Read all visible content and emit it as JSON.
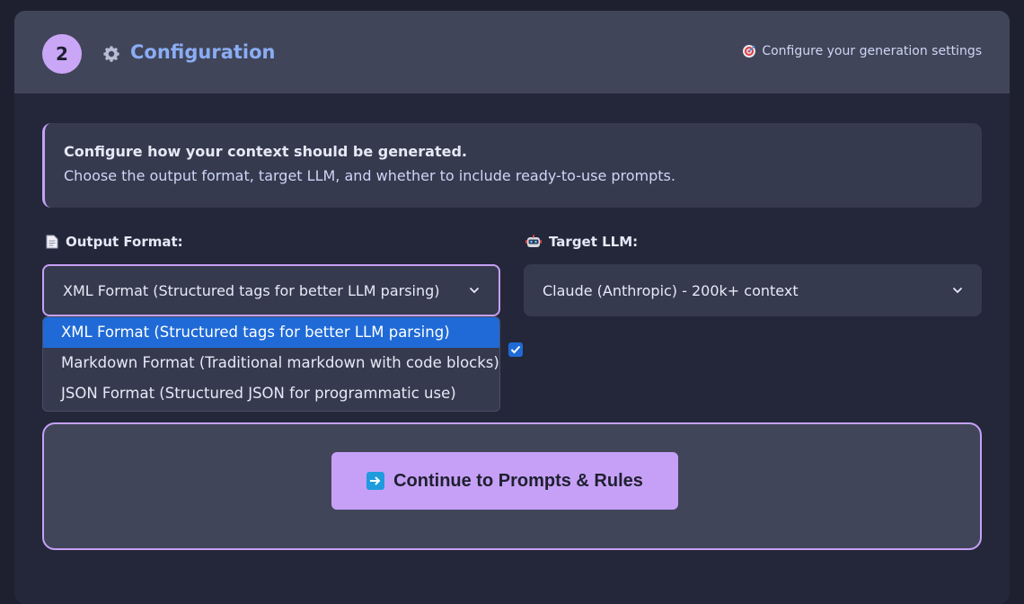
{
  "header": {
    "step_number": "2",
    "title": "Configuration",
    "hint": "Configure your generation settings"
  },
  "info": {
    "strong": "Configure how your context should be generated.",
    "text": "Choose the output format, target LLM, and whether to include ready-to-use prompts."
  },
  "output_format": {
    "label": "Output Format:",
    "selected": "XML Format (Structured tags for better LLM parsing)",
    "options": [
      "XML Format (Structured tags for better LLM parsing)",
      "Markdown Format (Traditional markdown with code blocks)",
      "JSON Format (Structured JSON for programmatic use)"
    ]
  },
  "target_llm": {
    "label": "Target LLM:",
    "selected": "Claude (Anthropic) - 200k+ context"
  },
  "include_prompts": {
    "checked": true
  },
  "continue_button": {
    "label": "Continue to Prompts & Rules"
  },
  "icons": [
    "gear-icon",
    "target-icon",
    "document-icon",
    "robot-icon",
    "chevron-down-icon",
    "arrow-right-icon",
    "checkmark-icon"
  ],
  "colors": {
    "accent": "#c6a0f6",
    "title": "#8aadf4",
    "selection": "#1f6ad6"
  }
}
